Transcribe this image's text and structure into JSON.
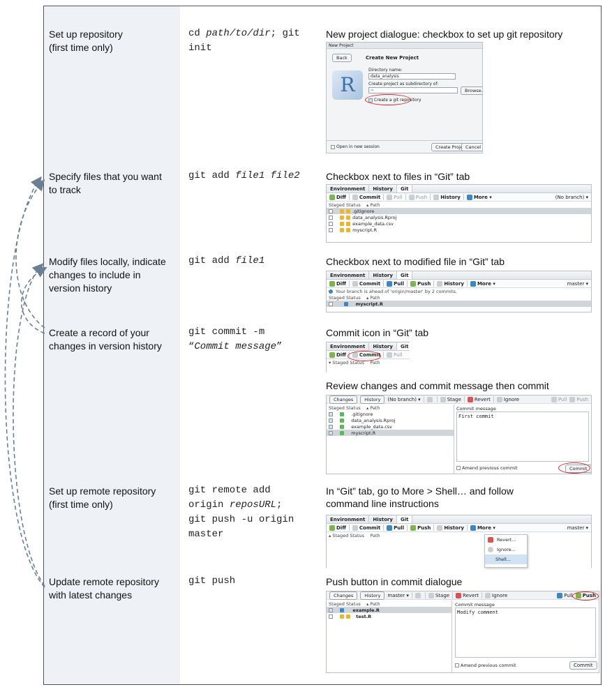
{
  "rows": [
    {
      "task": [
        "Set up repository",
        "(first time only)"
      ],
      "cmd": [
        "cd ",
        "path/to/dir",
        "; git",
        "init"
      ],
      "rs_caption": "New project dialogue: checkbox to set up git repository"
    },
    {
      "task": [
        "Specify files that you want",
        "to track"
      ],
      "cmd_plain": "git add ",
      "cmd_ital": "file1 file2",
      "rs_caption": "Checkbox next to files in “Git” tab"
    },
    {
      "task": [
        "Modify files locally, indicate",
        "changes to include in",
        "version history"
      ],
      "cmd_plain": "git add ",
      "cmd_ital": "file1",
      "rs_caption": "Checkbox next to modified file in “Git” tab"
    },
    {
      "task": [
        "Create a record of your",
        "changes in version history"
      ],
      "cmd_line1": "git commit -m",
      "cmd_line2_q1": "“",
      "cmd_line2_ital": "Commit message",
      "cmd_line2_q2": "”",
      "rs_caption": "Commit icon in “Git” tab",
      "rs_caption2": "Review changes and commit message then commit"
    },
    {
      "task": [
        "Set up remote repository",
        "(first time only)"
      ],
      "cmd_lines": [
        "git remote add",
        "origin ",
        "reposURL",
        ";",
        "git push -u origin",
        "master"
      ],
      "rs_caption": [
        "In “Git” tab, go to More > Shell… and follow",
        "command line instructions"
      ]
    },
    {
      "task": [
        "Update remote repository",
        "with latest changes"
      ],
      "cmd": "git push",
      "rs_caption": "Push button in commit dialogue"
    }
  ],
  "newproj": {
    "window_title": "New Project",
    "back": "Back",
    "title": "Create New Project",
    "dir_label": "Directory name:",
    "dir_value": "data_analysis",
    "sub_label": "Create project as subdirectory of:",
    "sub_value": "~",
    "browse": "Browse...",
    "git_checkbox": "Create a git repository",
    "open_new": "Open in new session",
    "create": "Create Project",
    "cancel": "Cancel",
    "logo": "R"
  },
  "gitpane": {
    "tabs": [
      "Environment",
      "History",
      "Git"
    ],
    "diff": "Diff",
    "commit": "Commit",
    "pull": "Pull",
    "push": "Push",
    "history": "History",
    "more": "More ▾",
    "no_branch": "(No branch) ▾",
    "master": "master ▾",
    "staged": "Staged",
    "status": "Status",
    "path": "▴ Path",
    "files": [
      ".gitignore",
      "data_analysis.Rproj",
      "example_data.csv",
      "myscript.R"
    ],
    "ahead": "Your branch is ahead of 'origin/master' by 2 commits.",
    "menu": [
      "Revert...",
      "Ignore...",
      "Shell..."
    ]
  },
  "commitdlg": {
    "changes": "Changes",
    "history": "History",
    "no_branch": "(No branch) ▾",
    "master": "master ▾",
    "stage": "Stage",
    "revert": "Revert",
    "ignore": "Ignore",
    "pull": "Pull",
    "push": "Push",
    "commit_msg_label": "Commit message",
    "msg1": "First commit",
    "msg2": "Modify comment",
    "amend": "Amend previous commit",
    "commit_btn": "Commit",
    "files2": [
      "example.R",
      "test.R"
    ]
  }
}
